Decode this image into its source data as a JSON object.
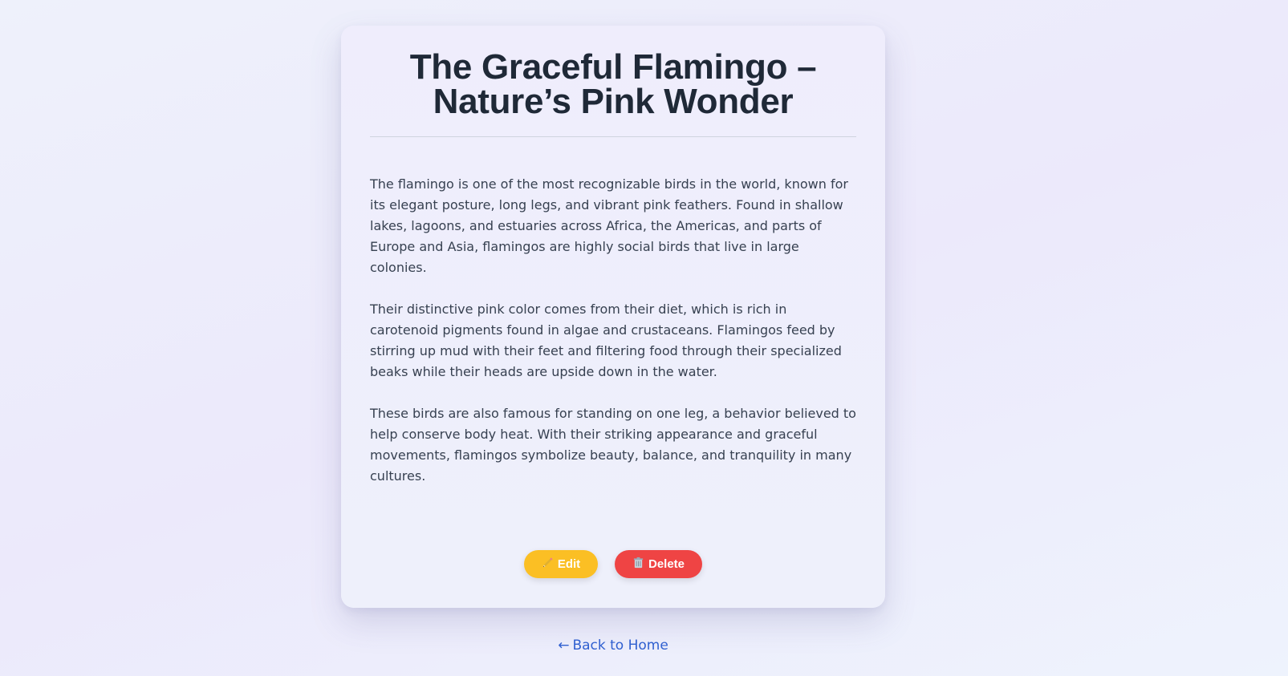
{
  "article": {
    "title": "The Graceful Flamingo – Nature’s Pink Wonder",
    "paragraphs": [
      "The flamingo is one of the most recognizable birds in the world, known for its elegant posture, long legs, and vibrant pink feathers. Found in shallow lakes, lagoons, and estuaries across Africa, the Americas, and parts of Europe and Asia, flamingos are highly social birds that live in large colonies.",
      "Their distinctive pink color comes from their diet, which is rich in carotenoid pigments found in algae and crustaceans. Flamingos feed by stirring up mud with their feet and filtering food through their specialized beaks while their heads are upside down in the water.",
      "These birds are also famous for standing on one leg, a behavior believed to help conserve body heat. With their striking appearance and graceful movements, flamingos symbolize beauty, balance, and tranquility in many cultures."
    ]
  },
  "actions": {
    "edit_label": "Edit",
    "edit_icon": "pencil-icon",
    "delete_label": "Delete",
    "delete_icon": "trash-icon"
  },
  "nav": {
    "back_arrow": "←",
    "back_label": "Back to Home"
  },
  "colors": {
    "edit": "#fbbf24",
    "delete": "#ef4444",
    "link": "#2f5fd0",
    "title": "#1f2937"
  }
}
